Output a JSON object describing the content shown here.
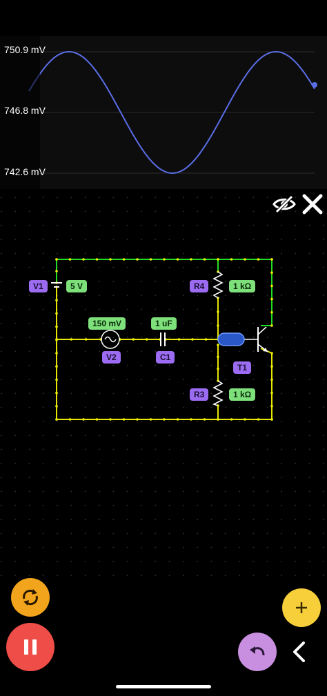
{
  "scope": {
    "y_labels": [
      "750.9 mV",
      "746.8 mV",
      "742.6 mV"
    ],
    "wave_color": "#5b6ee8"
  },
  "circuit": {
    "v1": {
      "name": "V1",
      "value": "5 V"
    },
    "v2": {
      "name": "V2",
      "value": "150 mV"
    },
    "c1": {
      "name": "C1",
      "value": "1 uF"
    },
    "r4": {
      "name": "R4",
      "value": "1 kΩ"
    },
    "r3": {
      "name": "R3",
      "value": "1 kΩ"
    },
    "t1": {
      "name": "T1"
    },
    "colors": {
      "high_wire": "#22dd22",
      "low_wire": "#e6e600",
      "name_badge": "#9b6cf2",
      "value_badge": "#7ee07a"
    }
  },
  "toolbar": {
    "hide_icon": "eye-off-icon",
    "close_icon": "close-icon",
    "reset_icon": "refresh-icon",
    "pause_icon": "pause-icon",
    "add_icon": "plus-icon",
    "undo_icon": "undo-icon",
    "back_icon": "chevron-left-icon",
    "colors": {
      "reset": "#f2a51c",
      "pause": "#ef4d47",
      "add": "#f7cf3a",
      "undo": "#c88fe0"
    }
  }
}
